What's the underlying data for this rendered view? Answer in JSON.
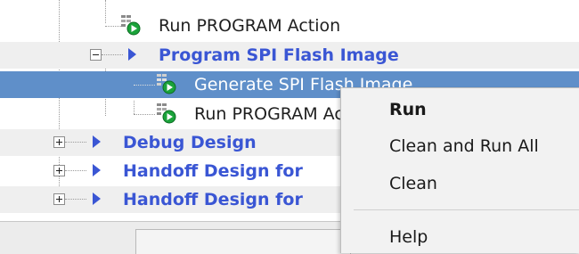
{
  "tree": {
    "items": [
      {
        "label": "Run PROGRAM Action",
        "icon": "process-run-icon"
      },
      {
        "label": "Program SPI Flash Image",
        "icon": "expand-arrow-icon"
      },
      {
        "label": "Generate SPI Flash Image",
        "icon": "process-run-icon",
        "selected": true
      },
      {
        "label": "Run PROGRAM Action",
        "icon": "process-run-icon"
      },
      {
        "label": "Debug Design",
        "icon": "expand-arrow-icon"
      },
      {
        "label": "Handoff Design for",
        "icon": "expand-arrow-icon"
      },
      {
        "label": "Handoff Design for",
        "icon": "expand-arrow-icon"
      }
    ]
  },
  "context_menu": {
    "items": [
      {
        "label": "Run",
        "bold": true
      },
      {
        "label": "Clean and Run All"
      },
      {
        "label": "Clean"
      },
      {
        "label": "Help"
      }
    ]
  },
  "colors": {
    "selection": "#5f8fc9",
    "group_text": "#3a56d4",
    "run_icon_green": "#1aa33a",
    "menu_background": "#f2f2f2"
  }
}
